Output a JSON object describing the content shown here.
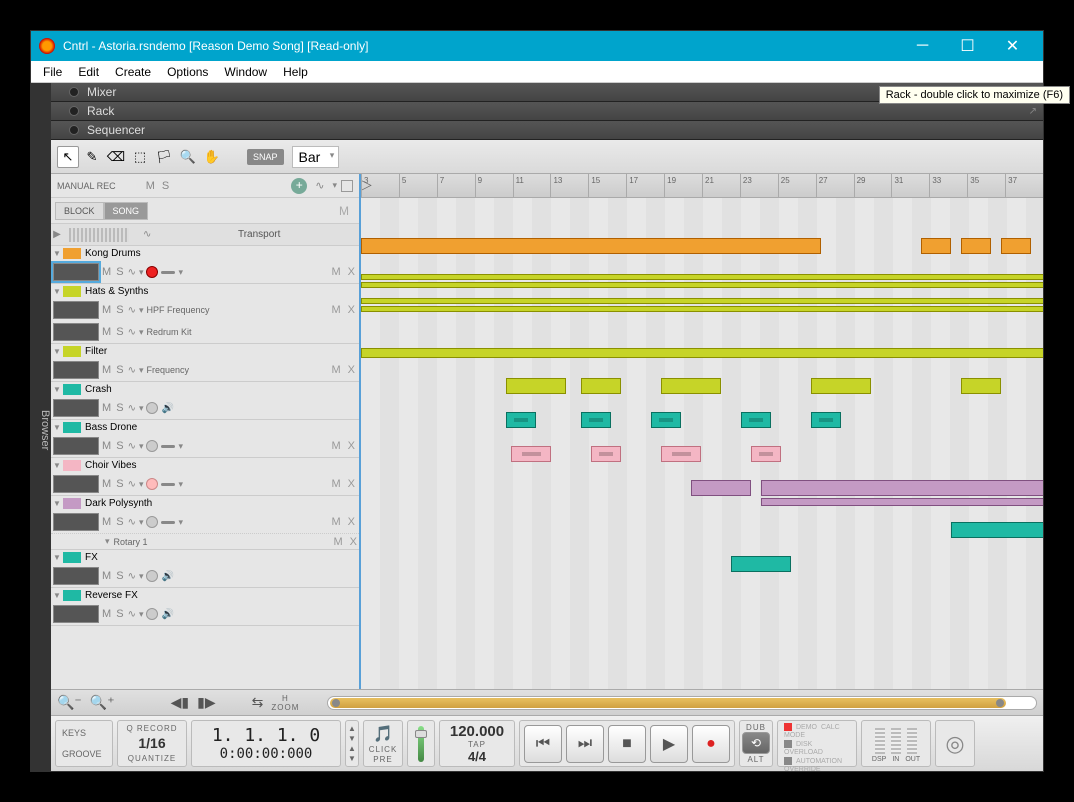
{
  "window": {
    "title": "Cntrl - Astoria.rsndemo [Reason Demo Song] [Read-only]"
  },
  "menu": [
    "File",
    "Edit",
    "Create",
    "Options",
    "Window",
    "Help"
  ],
  "browser_tab": "Browser",
  "panels": {
    "mixer": "Mixer",
    "rack": "Rack",
    "sequencer": "Sequencer"
  },
  "tooltip": "Rack - double click to maximize (F6)",
  "toolbar": {
    "tools": [
      "↖",
      "✎",
      "⌫",
      "⬚",
      "🏳",
      "🔍",
      "✋"
    ],
    "snap": "SNAP",
    "bar": "Bar"
  },
  "track_header": {
    "label": "MANUAL REC",
    "ms": "M S",
    "plus": "+",
    "wav": "∿"
  },
  "blocksong": {
    "block": "BLOCK",
    "song": "SONG",
    "m": "M"
  },
  "transport_row": {
    "label": "Transport"
  },
  "tracks": [
    {
      "name": "Kong Drums",
      "color": "org",
      "selected": true,
      "rec": "red",
      "dash": true,
      "mx": "M X"
    },
    {
      "name": "Hats & Synths",
      "color": "yel",
      "rec": null,
      "param": "HPF Frequency",
      "mx": "M X",
      "sub": {
        "label": "Redrum Kit",
        "thumb": true
      }
    },
    {
      "name": "Filter",
      "color": "yel",
      "param": "Frequency",
      "mx": "M X"
    },
    {
      "name": "Crash",
      "color": "teal",
      "rec": "gray",
      "speaker": true
    },
    {
      "name": "Bass Drone",
      "color": "teal",
      "rec": "gray",
      "dash": true,
      "mx": "M X"
    },
    {
      "name": "Choir Vibes",
      "color": "pink",
      "rec": "pink",
      "dash": true,
      "mx": "M X"
    },
    {
      "name": "Dark Polysynth",
      "color": "purp",
      "rec": "gray",
      "dash": true,
      "mx": "M X",
      "lane": "Rotary 1",
      "lane_mx": "M X"
    },
    {
      "name": "FX",
      "color": "teal",
      "rec": "gray",
      "speaker": true
    },
    {
      "name": "Reverse FX",
      "color": "teal",
      "rec": "gray",
      "speaker": true
    }
  ],
  "ruler": {
    "ticks": [
      "3",
      "5",
      "7",
      "9",
      "11",
      "13",
      "15",
      "17",
      "19",
      "21",
      "23",
      "25",
      "27",
      "29",
      "31",
      "33",
      "35",
      "37"
    ]
  },
  "zoom": {
    "h_label": "H",
    "zoom_label": "ZOOM"
  },
  "transport": {
    "keys": "KEYS",
    "groove": "GROOVE",
    "qrecord": "Q RECORD",
    "quantize": "QUANTIZE",
    "qval": "1/16",
    "pos_bars": "1. 1. 1.    0",
    "pos_time": "0:00:00:000",
    "click": "CLICK",
    "pre": "PRE",
    "tempo": "120.000",
    "tap": "TAP",
    "sig": "4/4",
    "dub": "DUB",
    "alt": "ALT",
    "demo": "DEMO",
    "mode": "MODE",
    "calc": "CALC",
    "disk": "DISK",
    "overload": "OVERLOAD",
    "auto": "AUTOMATION",
    "override": "OVERRIDE",
    "dsp": "DSP",
    "in": "IN",
    "out": "OUT"
  }
}
